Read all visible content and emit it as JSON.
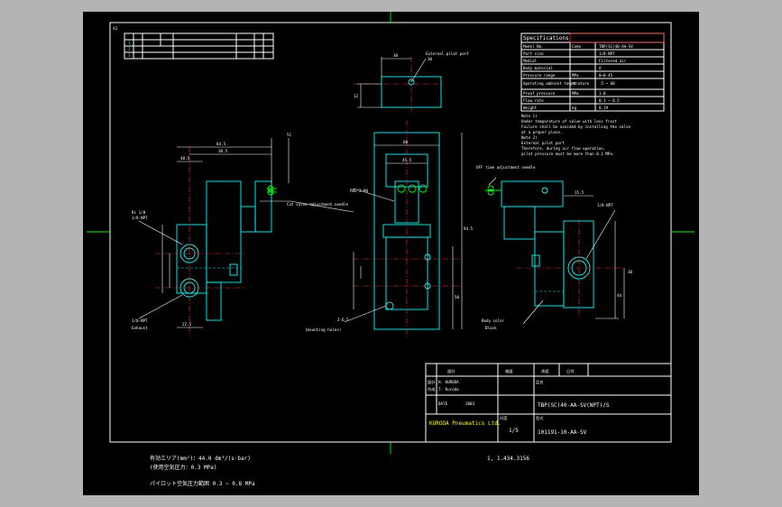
{
  "sheet": {
    "size_mark": "A3",
    "colors": {
      "background": "#000000",
      "frame": "#ffffff",
      "outline": "#00ffff",
      "dimension": "#ffffff",
      "center": "#ff0000",
      "highlight": "#00ff00",
      "accent": "#ffff00"
    }
  },
  "revision_table": {
    "rows": [
      "1",
      "2",
      "3"
    ]
  },
  "spec_table": {
    "title": "Specifications",
    "rows": [
      {
        "item": "Model No.",
        "unit": "Code",
        "value": "TBP(SC)40-AA-SV"
      },
      {
        "item": "Port size",
        "unit": "",
        "value": "1/8-NPT"
      },
      {
        "item": "Medial",
        "unit": "",
        "value": "Filtered air"
      },
      {
        "item": "Body material",
        "unit": "",
        "value": "A"
      },
      {
        "item": "Pressure range",
        "unit": "MPa",
        "value": "0~0.45"
      },
      {
        "item": "Operating ambient temperature",
        "unit": "℃",
        "value": "-5 ~ 60"
      },
      {
        "item": "Proof pressure",
        "unit": "MPa",
        "value": "1.0"
      },
      {
        "item": "Flow rate",
        "unit": "",
        "value": "0.3 ~ 0.5"
      },
      {
        "item": "Weight",
        "unit": "kg",
        "value": "0.19"
      }
    ],
    "notes_label": "Note 1)",
    "notes": [
      "Under temperature of valve with less frost",
      "Failure shall be avoided by installing the valve",
      "at a proper place.",
      "Note 2)",
      "External pilot port",
      "Therefore, during air flow operation,",
      "pilot pressure must be more than 0.1 MPa."
    ]
  },
  "views": {
    "top": {
      "label": "External pilot port",
      "callout": "30",
      "dims": [
        "30",
        "12"
      ]
    },
    "left": {
      "dims": [
        "64.5",
        "30.5",
        "48.5",
        "22.5",
        "51"
      ],
      "labels": [
        "Rc 1/8",
        "1/8-NPT",
        "1/8-NPT",
        "Exhaust",
        "Cut valve adjustment needle"
      ]
    },
    "center": {
      "dims": [
        "60",
        "45.5",
        "94.5",
        "50",
        "2-6.5"
      ],
      "labels": [
        "PBS-2-M4",
        "(mounting holes)"
      ]
    },
    "right": {
      "dims": [
        "15.5",
        "30",
        "44"
      ],
      "labels": [
        "OFF time adjustment needle",
        "1/8-NPT",
        "Body color",
        "Black"
      ]
    }
  },
  "title_block": {
    "header_cells": [
      "設計",
      "検図",
      "承認",
      "日付"
    ],
    "fields": [
      {
        "label": "設計",
        "value": "H. KURODA"
      },
      {
        "label": "作成",
        "value": "T. Kuroda"
      },
      {
        "label": "品名",
        "value": "TBP(SC)40-AA-SV(NPT)/S"
      },
      {
        "label": "型式",
        "value": "101191-10-AA-SV"
      },
      {
        "label": "尺度",
        "value": "1/5"
      }
    ],
    "company": "KURODA Pneumatics Ltd.",
    "date_label": "DATE",
    "date_value": "2003"
  },
  "bottom_notes": {
    "line1": "有効エリア(mm²)：44.0 dm³/(s·bar)",
    "line2": "(使用空気圧力：0.3 MPa)",
    "line3": "パイロット空気圧力範囲 0.3 ~ 0.8 MPa",
    "drawing_no": "1, 1.434.3156"
  }
}
